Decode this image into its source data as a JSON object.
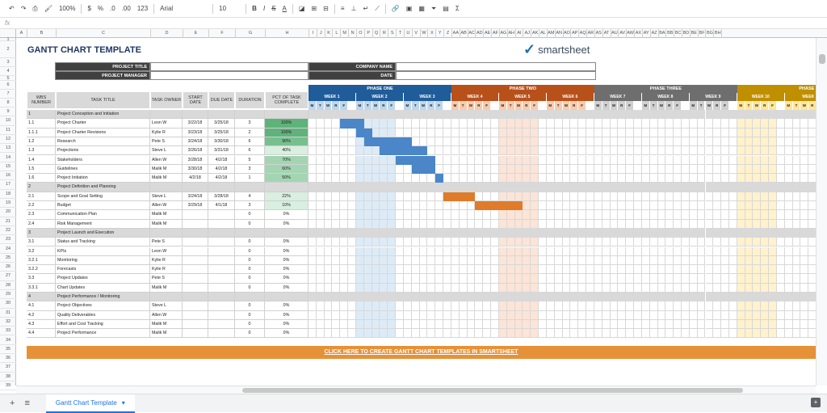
{
  "toolbar": {
    "zoom": "100%",
    "currency": "$",
    "percent": "%",
    "decimal_dec": ".0",
    "decimal_inc": ".00",
    "format_more": "123",
    "font": "Arial",
    "font_size": "10",
    "bold": "B",
    "italic": "I",
    "strike": "S",
    "text_color": "A",
    "function": "Σ"
  },
  "formula_bar": {
    "fx": "fx"
  },
  "columns": [
    "A",
    "B",
    "C",
    "D",
    "E",
    "F",
    "G",
    "H",
    "I",
    "J",
    "K",
    "L",
    "M",
    "N",
    "O",
    "P",
    "Q",
    "R",
    "S",
    "T",
    "U",
    "V",
    "W",
    "X",
    "Y",
    "Z",
    "AA",
    "AB",
    "AC",
    "AD",
    "AE",
    "AF",
    "AG",
    "AH",
    "AI",
    "AJ",
    "AK",
    "AL",
    "AM",
    "AN",
    "AO",
    "AP",
    "AQ",
    "AR",
    "AS",
    "AT",
    "AU",
    "AV",
    "AW",
    "AX",
    "AY",
    "AZ",
    "BA",
    "BB",
    "BC",
    "BD",
    "BE",
    "BF",
    "BG",
    "BH"
  ],
  "rows": [
    "1",
    "2",
    "3",
    "4",
    "5",
    "6",
    "7",
    "8",
    "9",
    "10",
    "11",
    "12",
    "13",
    "14",
    "15",
    "16",
    "17",
    "18",
    "19",
    "20",
    "21",
    "22",
    "23",
    "24",
    "25",
    "26",
    "27",
    "28",
    "29",
    "30",
    "31",
    "32",
    "33",
    "34",
    "35",
    "36",
    "37",
    "38",
    "39"
  ],
  "sheet": {
    "title": "GANTT CHART TEMPLATE",
    "logo_text": "smartsheet",
    "project_title_label": "PROJECT TITLE",
    "project_manager_label": "PROJECT MANAGER",
    "company_name_label": "COMPANY NAME",
    "date_label": "DATE",
    "headers": {
      "wbs": "WBS NUMBER",
      "task": "TASK TITLE",
      "owner": "TASK OWNER",
      "start": "START DATE",
      "due": "DUE DATE",
      "duration": "DURATION",
      "pct": "PCT OF TASK COMPLETE"
    },
    "phases": [
      {
        "label": "PHASE ONE",
        "color": "#1f5c99"
      },
      {
        "label": "PHASE TWO",
        "color": "#b8501a"
      },
      {
        "label": "PHASE THREE",
        "color": "#6e6e6e"
      },
      {
        "label": "PHASE F",
        "color": "#bf8f00"
      }
    ],
    "weeks": [
      "WEEK 1",
      "WEEK 2",
      "WEEK 3",
      "WEEK 4",
      "WEEK 5",
      "WEEK 6",
      "WEEK 7",
      "WEEK 8",
      "WEEK 9",
      "WEEK 10",
      "WEEK"
    ],
    "days": [
      "M",
      "T",
      "W",
      "R",
      "F"
    ],
    "tasks": [
      {
        "wbs": "1",
        "title": "Project Conception and Initiation",
        "owner": "",
        "start": "",
        "due": "",
        "duration": "",
        "pct": "",
        "section": true
      },
      {
        "wbs": "1.1",
        "title": "Project Charter",
        "owner": "Leon W",
        "start": "3/22/18",
        "due": "3/25/18",
        "duration": "3",
        "pct": "100%",
        "section": false
      },
      {
        "wbs": "1.1.1",
        "title": "Project Charter Revisions",
        "owner": "Kylie R",
        "start": "3/23/18",
        "due": "3/25/18",
        "duration": "2",
        "pct": "100%",
        "section": false
      },
      {
        "wbs": "1.2",
        "title": "Research",
        "owner": "Pete S",
        "start": "3/24/18",
        "due": "3/30/18",
        "duration": "6",
        "pct": "90%",
        "section": false
      },
      {
        "wbs": "1.3",
        "title": "Projections",
        "owner": "Steve L",
        "start": "3/26/18",
        "due": "3/31/18",
        "duration": "6",
        "pct": "40%",
        "section": false
      },
      {
        "wbs": "1.4",
        "title": "Stakeholders",
        "owner": "Allen W",
        "start": "3/28/18",
        "due": "4/2/18",
        "duration": "5",
        "pct": "70%",
        "section": false
      },
      {
        "wbs": "1.5",
        "title": "Guidelines",
        "owner": "Malik M",
        "start": "3/30/18",
        "due": "4/2/18",
        "duration": "3",
        "pct": "60%",
        "section": false
      },
      {
        "wbs": "1.6",
        "title": "Project Initiation",
        "owner": "Malik M",
        "start": "4/2/18",
        "due": "4/2/18",
        "duration": "1",
        "pct": "50%",
        "section": false
      },
      {
        "wbs": "2",
        "title": "Project Definition and Planning",
        "owner": "",
        "start": "",
        "due": "",
        "duration": "",
        "pct": "",
        "section": true
      },
      {
        "wbs": "2.1",
        "title": "Scope and Goal Setting",
        "owner": "Steve L",
        "start": "3/24/18",
        "due": "3/28/18",
        "duration": "4",
        "pct": "22%",
        "section": false
      },
      {
        "wbs": "2.2",
        "title": "Budget",
        "owner": "Allen W",
        "start": "3/29/18",
        "due": "4/1/18",
        "duration": "3",
        "pct": "10%",
        "section": false
      },
      {
        "wbs": "2.3",
        "title": "Communication Plan",
        "owner": "Malik M",
        "start": "",
        "due": "",
        "duration": "0",
        "pct": "0%",
        "section": false
      },
      {
        "wbs": "2.4",
        "title": "Risk Management",
        "owner": "Malik M",
        "start": "",
        "due": "",
        "duration": "0",
        "pct": "0%",
        "section": false
      },
      {
        "wbs": "3",
        "title": "Project Launch and Execution",
        "owner": "",
        "start": "",
        "due": "",
        "duration": "",
        "pct": "",
        "section": true
      },
      {
        "wbs": "3.1",
        "title": "Status and Tracking",
        "owner": "Pete S",
        "start": "",
        "due": "",
        "duration": "0",
        "pct": "0%",
        "section": false
      },
      {
        "wbs": "3.2",
        "title": "KPIs",
        "owner": "Leon W",
        "start": "",
        "due": "",
        "duration": "0",
        "pct": "0%",
        "section": false
      },
      {
        "wbs": "3.2.1",
        "title": "Monitoring",
        "owner": "Kylie R",
        "start": "",
        "due": "",
        "duration": "0",
        "pct": "0%",
        "section": false
      },
      {
        "wbs": "3.2.2",
        "title": "Forecasts",
        "owner": "Kylie R",
        "start": "",
        "due": "",
        "duration": "0",
        "pct": "0%",
        "section": false
      },
      {
        "wbs": "3.3",
        "title": "Project Updates",
        "owner": "Pete S",
        "start": "",
        "due": "",
        "duration": "0",
        "pct": "0%",
        "section": false
      },
      {
        "wbs": "3.3.1",
        "title": "Chart Updates",
        "owner": "Malik M",
        "start": "",
        "due": "",
        "duration": "0",
        "pct": "0%",
        "section": false
      },
      {
        "wbs": "4",
        "title": "Project Performance / Monitoring",
        "owner": "",
        "start": "",
        "due": "",
        "duration": "",
        "pct": "",
        "section": true
      },
      {
        "wbs": "4.1",
        "title": "Project Objectives",
        "owner": "Steve L",
        "start": "",
        "due": "",
        "duration": "0",
        "pct": "0%",
        "section": false
      },
      {
        "wbs": "4.2",
        "title": "Quality Deliverables",
        "owner": "Allen W",
        "start": "",
        "due": "",
        "duration": "0",
        "pct": "0%",
        "section": false
      },
      {
        "wbs": "4.3",
        "title": "Effort and Cost Tracking",
        "owner": "Malik M",
        "start": "",
        "due": "",
        "duration": "0",
        "pct": "0%",
        "section": false
      },
      {
        "wbs": "4.4",
        "title": "Project Performance",
        "owner": "Malik M",
        "start": "",
        "due": "",
        "duration": "0",
        "pct": "0%",
        "section": false
      }
    ],
    "bars": [
      {
        "row": 1,
        "start": 4,
        "len": 3,
        "color": "#4a86c8"
      },
      {
        "row": 2,
        "start": 6,
        "len": 2,
        "color": "#4a86c8"
      },
      {
        "row": 3,
        "start": 7,
        "len": 6,
        "color": "#4a86c8"
      },
      {
        "row": 4,
        "start": 9,
        "len": 6,
        "color": "#4a86c8"
      },
      {
        "row": 5,
        "start": 11,
        "len": 5,
        "color": "#4a86c8"
      },
      {
        "row": 6,
        "start": 13,
        "len": 3,
        "color": "#4a86c8"
      },
      {
        "row": 7,
        "start": 16,
        "len": 1,
        "color": "#4a86c8"
      },
      {
        "row": 9,
        "start": 17,
        "len": 4,
        "color": "#e07b2a"
      },
      {
        "row": 10,
        "start": 21,
        "len": 6,
        "color": "#e07b2a"
      }
    ],
    "cta": "CLICK HERE TO CREATE GANTT CHART TEMPLATES IN SMARTSHEET"
  },
  "tabs": {
    "active": "Gantt Chart Template",
    "add": "+",
    "list": "≡",
    "caret": "▾"
  }
}
